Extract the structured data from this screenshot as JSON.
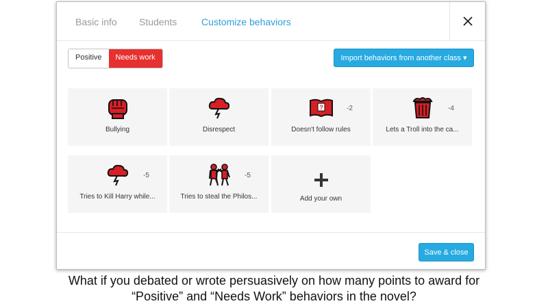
{
  "colors": {
    "accent": "#2a9fd6",
    "needs_work_red": "#e5312f",
    "button_blue": "#26aae1",
    "card_bg": "#f5f5f5"
  },
  "modal": {
    "tabs": [
      {
        "label": "Basic info"
      },
      {
        "label": "Students"
      },
      {
        "label": "Customize behaviors",
        "active": true
      }
    ],
    "close_icon": "close-icon"
  },
  "toolbar": {
    "positive_label": "Positive",
    "needs_work_label": "Needs work",
    "import_label": "Import behaviors from another class ▾"
  },
  "behaviors": [
    {
      "label": "Bullying",
      "points": "",
      "icon": "fist-icon"
    },
    {
      "label": "Disrespect",
      "points": "",
      "icon": "storm-cloud-icon"
    },
    {
      "label": "Doesn't follow rules",
      "points": "-2",
      "icon": "rulebook-icon"
    },
    {
      "label": "Lets a Troll into the ca...",
      "points": "-4",
      "icon": "trash-can-icon"
    },
    {
      "label": "Tries to Kill Harry while...",
      "points": "-5",
      "icon": "storm-cloud-icon"
    },
    {
      "label": "Tries to steal the Philos...",
      "points": "-5",
      "icon": "fighting-figures-icon"
    }
  ],
  "add_card": {
    "label": "Add your own",
    "icon": "plus-icon"
  },
  "footer": {
    "save_label": "Save & close"
  },
  "caption": {
    "line1": "What if you debated or wrote persuasively on how many points to award for",
    "line2": "“Positive” and “Needs Work” behaviors in the novel?"
  }
}
